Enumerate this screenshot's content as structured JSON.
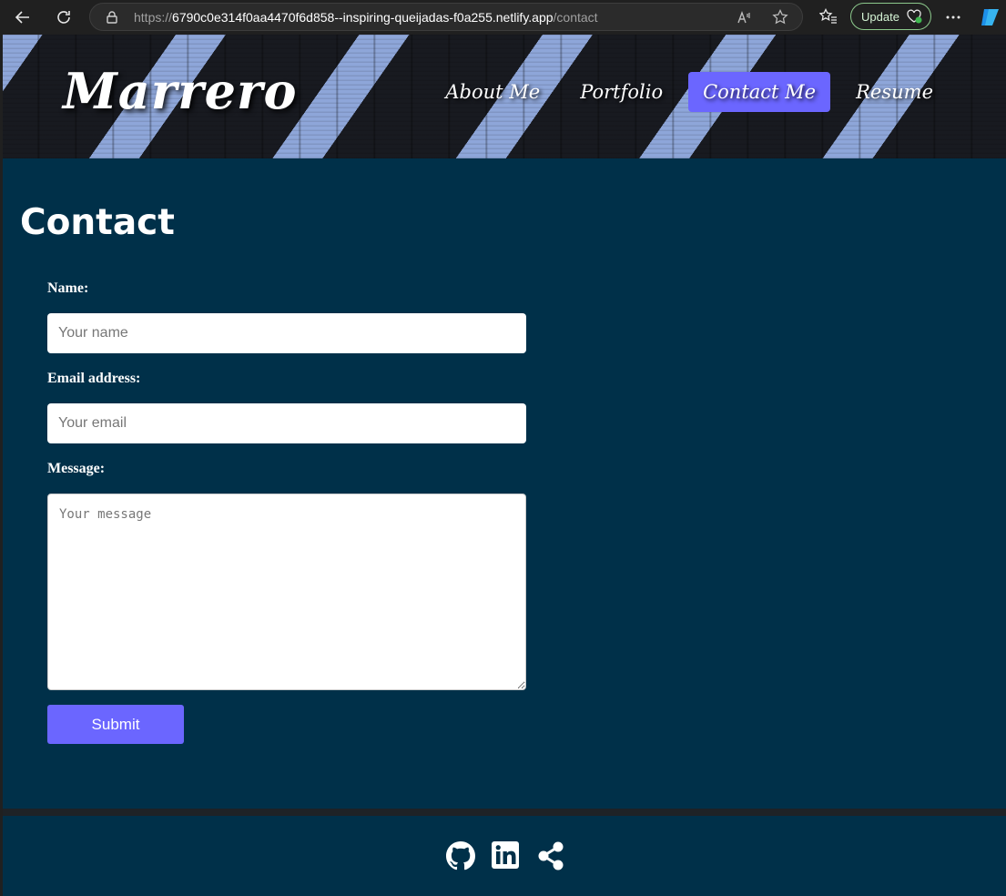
{
  "browser": {
    "url_scheme": "https://",
    "url_host": "6790c0e314f0aa4470f6d858--inspiring-queijadas-f0a255.netlify.app",
    "url_path": "/contact",
    "update_label": "Update"
  },
  "header": {
    "brand": "Marrero",
    "nav": [
      {
        "label": "About Me",
        "active": false
      },
      {
        "label": "Portfolio",
        "active": false
      },
      {
        "label": "Contact Me",
        "active": true
      },
      {
        "label": "Resume",
        "active": false
      }
    ]
  },
  "main": {
    "title": "Contact",
    "form": {
      "name_label": "Name:",
      "name_placeholder": "Your name",
      "email_label": "Email address:",
      "email_placeholder": "Your email",
      "message_label": "Message:",
      "message_placeholder": "Your message",
      "submit_label": "Submit"
    }
  },
  "footer": {
    "icons": [
      "github-icon",
      "linkedin-icon",
      "share-icon"
    ]
  },
  "colors": {
    "page_background": "#003049",
    "accent": "#6b66ff",
    "browser_chrome": "#202020"
  }
}
